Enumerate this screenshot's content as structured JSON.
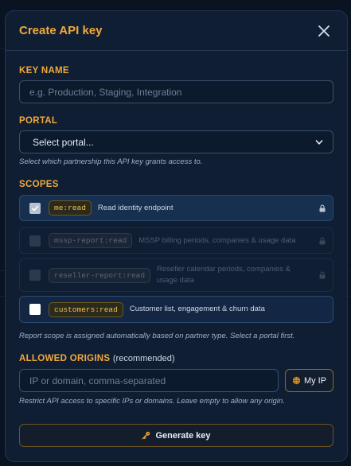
{
  "modal": {
    "title": "Create API key"
  },
  "key_name": {
    "label": "KEY NAME",
    "placeholder": "e.g. Production, Staging, Integration",
    "value": ""
  },
  "portal": {
    "label": "PORTAL",
    "selected": "Select portal...",
    "hint": "Select which partnership this API key grants access to."
  },
  "scopes": {
    "label": "SCOPES",
    "items": [
      {
        "code": "me:read",
        "description": "Read identity endpoint",
        "checked": true,
        "locked": true,
        "enabled": true
      },
      {
        "code": "mssp-report:read",
        "description": "MSSP billing periods, companies & usage data",
        "checked": false,
        "locked": true,
        "enabled": false
      },
      {
        "code": "reseller-report:read",
        "description": "Reseller calendar periods, companies & usage data",
        "checked": false,
        "locked": true,
        "enabled": false
      },
      {
        "code": "customers:read",
        "description": "Customer list, engagement & churn data",
        "checked": false,
        "locked": false,
        "enabled": true
      }
    ],
    "hint": "Report scope is assigned automatically based on partner type. Select a portal first."
  },
  "origins": {
    "label": "ALLOWED ORIGINS",
    "label_suffix": "(recommended)",
    "placeholder": "IP or domain, comma-separated",
    "myip_label": "My IP",
    "hint": "Restrict API access to specific IPs or domains. Leave empty to allow any origin."
  },
  "actions": {
    "generate_label": "Generate key"
  },
  "colors": {
    "accent": "#f2a93b",
    "panel": "#0f1e33",
    "active_scope": "#17304f"
  }
}
